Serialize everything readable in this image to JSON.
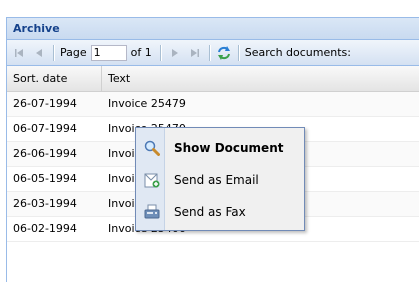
{
  "panel": {
    "title": "Archive"
  },
  "toolbar": {
    "page_label": "Page",
    "page_value": "1",
    "of_label": "of 1",
    "search_label": "Search documents:"
  },
  "grid": {
    "columns": [
      "Sort. date",
      "Text"
    ],
    "rows": [
      {
        "date": "26-07-1994",
        "text": "Invoice 25479"
      },
      {
        "date": "06-07-1994",
        "text": "Invoice 25470"
      },
      {
        "date": "26-06-1994",
        "text": "Invoice 25460"
      },
      {
        "date": "06-05-1994",
        "text": "Invoice 25440"
      },
      {
        "date": "26-03-1994",
        "text": "Invoice 25419"
      },
      {
        "date": "06-02-1994",
        "text": "Invoice 25406"
      }
    ]
  },
  "context_menu": {
    "items": [
      {
        "label": "Show Document",
        "icon": "magnifier-icon"
      },
      {
        "label": "Send as Email",
        "icon": "email-icon"
      },
      {
        "label": "Send as Fax",
        "icon": "fax-icon"
      }
    ]
  }
}
